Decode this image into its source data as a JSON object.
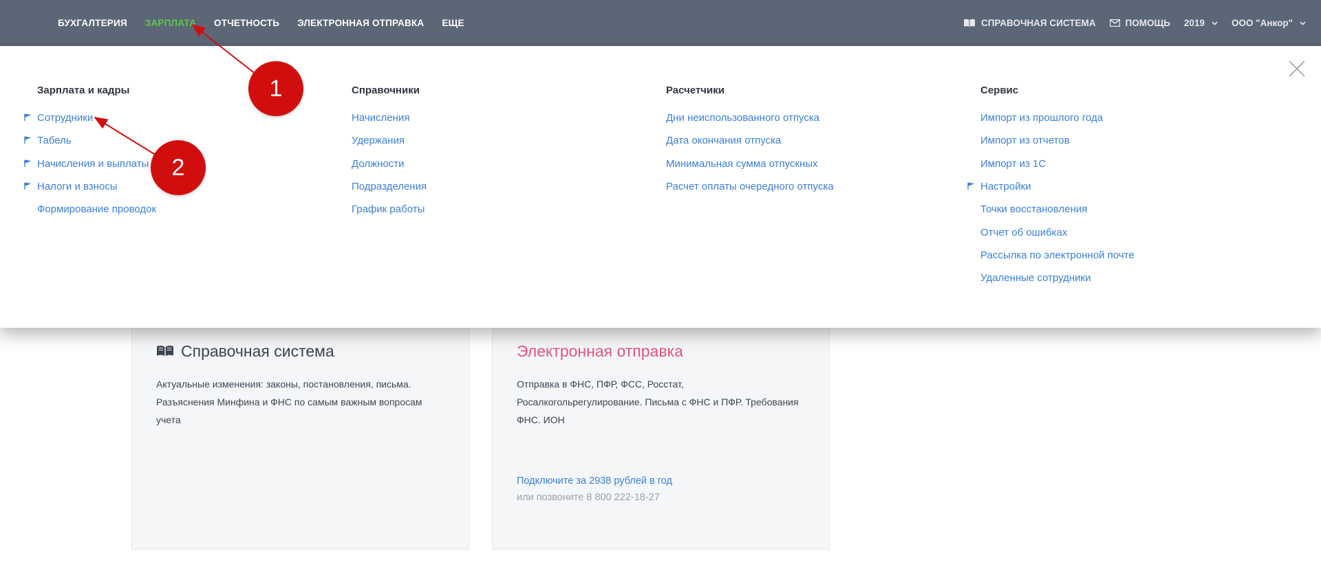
{
  "topbar": {
    "nav": [
      "БУХГАЛТЕРИЯ",
      "ЗАРПЛАТА",
      "ОТЧЕТНОСТЬ",
      "ЭЛЕКТРОННАЯ ОТПРАВКА",
      "ЕЩЕ"
    ],
    "active_index": 1,
    "reference_label": "СПРАВОЧНАЯ СИСТЕМА",
    "help_label": "ПОМОЩЬ",
    "year": "2019",
    "org": "ООО \"Анкор\""
  },
  "menu": {
    "columns": [
      {
        "title": "Зарплата и кадры",
        "items": [
          {
            "label": "Сотрудники",
            "flag": true
          },
          {
            "label": "Табель",
            "flag": true
          },
          {
            "label": "Начисления и выплаты",
            "flag": true
          },
          {
            "label": "Налоги и взносы",
            "flag": true
          },
          {
            "label": "Формирование проводок",
            "flag": false
          }
        ]
      },
      {
        "title": "Справочники",
        "items": [
          {
            "label": "Начисления",
            "flag": false
          },
          {
            "label": "Удержания",
            "flag": false
          },
          {
            "label": "Должности",
            "flag": false
          },
          {
            "label": "Подразделения",
            "flag": false
          },
          {
            "label": "График работы",
            "flag": false
          }
        ]
      },
      {
        "title": "Расчетчики",
        "items": [
          {
            "label": "Дни неиспользованного отпуска",
            "flag": false
          },
          {
            "label": "Дата окончания отпуска",
            "flag": false
          },
          {
            "label": "Минимальная сумма отпускных",
            "flag": false
          },
          {
            "label": "Расчет оплаты очередного отпуска",
            "flag": false
          }
        ]
      },
      {
        "title": "Сервис",
        "items": [
          {
            "label": "Импорт из прошлого года",
            "flag": false
          },
          {
            "label": "Импорт из отчетов",
            "flag": false
          },
          {
            "label": "Импорт из 1С",
            "flag": false
          },
          {
            "label": "Настройки",
            "flag": true
          },
          {
            "label": "Точки восстановления",
            "flag": false
          },
          {
            "label": "Отчет об ошибках",
            "flag": false
          },
          {
            "label": "Рассылка по электронной почте",
            "flag": false
          },
          {
            "label": "Удаленные сотрудники",
            "flag": false
          }
        ]
      }
    ]
  },
  "cards": {
    "reference": {
      "title": "Справочная система",
      "text": "Актуальные изменения: законы, постановления, письма. Разъяснения Минфина и ФНС по самым важным вопросам учета"
    },
    "efiling": {
      "title": "Электронная отправка",
      "text": "Отправка в ФНС, ПФР, ФСС, Росстат, Росалкогольрегулирование. Письма с ФНС и ПФР. Требования ФНС. ИОН",
      "link": "Подключите за 2938 рублей в год",
      "sub": "или позвоните 8 800 222-18-27"
    }
  },
  "annotations": [
    "1",
    "2"
  ],
  "colors": {
    "topbar": "#5b6676",
    "active_nav": "#5ec94a",
    "link": "#3a7fd6",
    "badge": "#d10e0e",
    "card_title_pink": "#e3557a"
  },
  "icons": {
    "reference": "book-icon",
    "help": "envelope-icon",
    "dropdown": "chevron-down-icon",
    "close": "close-icon",
    "flag": "flag-icon"
  }
}
